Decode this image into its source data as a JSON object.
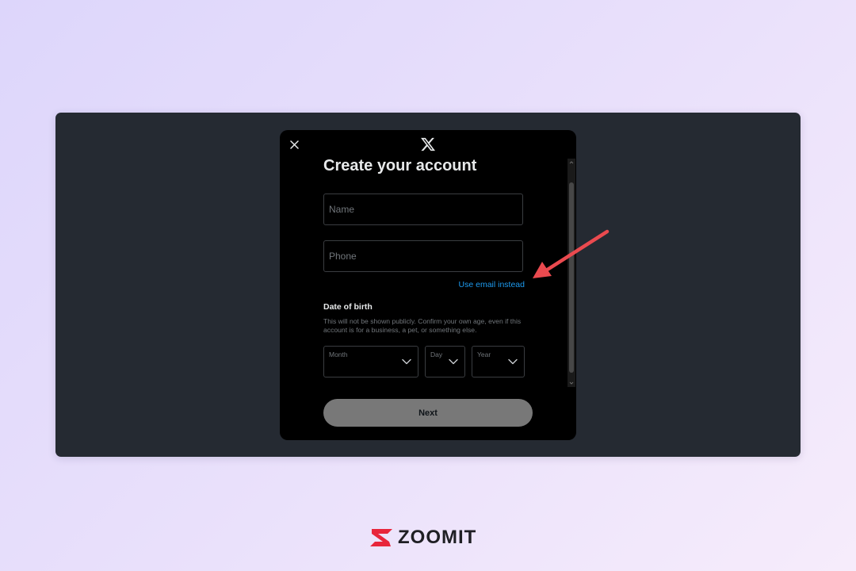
{
  "modal": {
    "title": "Create your account",
    "name_placeholder": "Name",
    "phone_placeholder": "Phone",
    "use_email_link": "Use email instead",
    "dob": {
      "label": "Date of birth",
      "help": "This will not be shown publicly. Confirm your own age, even if this account is for a business, a pet, or something else.",
      "month_label": "Month",
      "day_label": "Day",
      "year_label": "Year"
    },
    "next_label": "Next"
  },
  "icons": {
    "close": "close-icon",
    "logo": "x-logo-icon",
    "chevron": "chevron-down-icon"
  },
  "colors": {
    "link": "#1d9bf0",
    "annotation_arrow": "#ea4a4f",
    "brand": "#e8263b"
  },
  "watermark": {
    "name": "ZOOMIT"
  }
}
